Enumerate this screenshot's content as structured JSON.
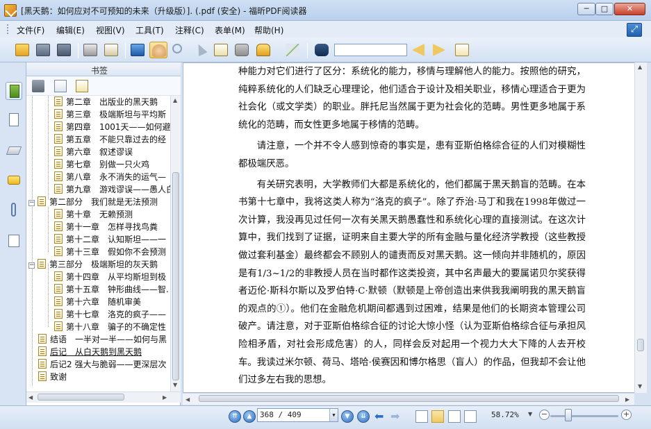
{
  "window": {
    "title": "[黑天鹅：如何应对不可预知的未来（升级版）]. (.pdf (安全) - 福昕PDF阅读器",
    "min": "─",
    "max": "□",
    "close": "✕"
  },
  "menu": [
    "文件(F)",
    "编辑(E)",
    "视图(V)",
    "工具(T)",
    "注释(C)",
    "表单(M)",
    "帮助(H)"
  ],
  "toolbar": {
    "search_value": "",
    "icons": [
      "open-folder-icon",
      "save-icon",
      "save-as-icon",
      "print-icon",
      "email-icon",
      "fullscreen-icon",
      "hand-tool-icon",
      "zoom-tool-icon",
      "select-icon",
      "text-select-icon",
      "snapshot-icon",
      "rms-lock-icon",
      "sign-icon",
      "binoculars-icon",
      "find-prev-icon",
      "find-next-icon",
      "highlight-icon"
    ]
  },
  "sidebar": {
    "panel_title": "书签",
    "bookmarks": [
      {
        "label": "第二章　出版业的黑天鹅",
        "level": 2
      },
      {
        "label": "第三章　极端斯坦与平均斯",
        "level": 2
      },
      {
        "label": "第四章　1001天——如何避",
        "level": 2
      },
      {
        "label": "第五章　不能只靠过去的经",
        "level": 2
      },
      {
        "label": "第六章　叙述谬误",
        "level": 2
      },
      {
        "label": "第七章　别做一只火鸡",
        "level": 2
      },
      {
        "label": "第八章　永不消失的运气—",
        "level": 2
      },
      {
        "label": "第九章　游戏谬误——愚人白",
        "level": 2
      },
      {
        "label": "第二部分　我们就是无法预测",
        "level": 1,
        "toggle": "−"
      },
      {
        "label": "第十章　无赖预测",
        "level": 2
      },
      {
        "label": "第十一章　怎样寻找鸟粪",
        "level": 2
      },
      {
        "label": "第十二章　认知斯坦——一",
        "level": 2
      },
      {
        "label": "第十三章　假如你不会预测",
        "level": 2
      },
      {
        "label": "第三部分　极端斯坦的灰天鹅",
        "level": 1,
        "toggle": "−"
      },
      {
        "label": "第十四章　从平均斯坦到极",
        "level": 2
      },
      {
        "label": "第十五章　钟形曲线——智.",
        "level": 2
      },
      {
        "label": "第十六章　随机审美",
        "level": 2
      },
      {
        "label": "第十七章　洛克的疯子——",
        "level": 2
      },
      {
        "label": "第十八章　骗子的不确定性",
        "level": 2
      },
      {
        "label": "结语　一半对一半——如何与黑",
        "level": 1
      },
      {
        "label": "后记　从白天鹅到黑天鹅",
        "level": 1,
        "underline": true
      },
      {
        "label": "后记2 强大与脆弱——更深层次",
        "level": 1
      },
      {
        "label": "致谢",
        "level": 1
      }
    ]
  },
  "document": {
    "paragraphs": [
      {
        "text": "种能力对它们进行了区分：系统化的能力，移情与理解他人的能力。按照他的研究，纯粹系统化的人们缺乏心理理论，他们适合于设计及相关职业，移情心理适合于更为社会化（或文学类）的职业。胖托尼当然属于更为社会化的范畴。男性更多地属于系统化的范畴，而女性更多地属于移情的范畴。",
        "first": true
      },
      {
        "text": "请注意，一个并不令人感到惊奇的事实是，患有亚斯伯格综合征的人们对模糊性都极端厌恶。",
        "first": false
      },
      {
        "text": "有关研究表明，大学教师们大都是系统化的，他们都属于黑天鹅盲的范畴。在本书第十七章中，我将这类人称为“洛克的疯子”。除了乔治·马丁和我在1998年做过一次计算，我没再见过任何一次有关黑天鹅愚蠢性和系统化心理的直接测试。在这次计算中，我们找到了证据，证明来自主要大学的所有金融与量化经济学教授（这些教授做过套利基金）最终都会不顾别人的谴责而反对黑天鹅。这一倾向并非随机的，原因是有1/3~1/2的非教授人员在当时都作这类投资，其中名声最大的要属诺贝尔奖获得者迈伦·斯科尔斯以及罗伯特·C·默顿（默顿是上帝创造出来供我我阐明我的黑天鹅盲的观点的①）。他们在金融危机期间都遇到过困难，结果是他们的长期资本管理公司破产。请注意，对于亚斯伯格综合征的讨论大惊小怪（认为亚斯伯格综合征与承担风险相矛盾，对社会形成危害）的人，同样会反对起用一个视力大大下降的人去开校车。我读过米尔顿、荷马、塔哈·侯赛因和博尔格思（盲人）的作品，但我却不会让他们过多左右我的思想。",
        "first": false
      }
    ]
  },
  "status": {
    "page_display": "368 / 409",
    "zoom": "58.72%"
  }
}
